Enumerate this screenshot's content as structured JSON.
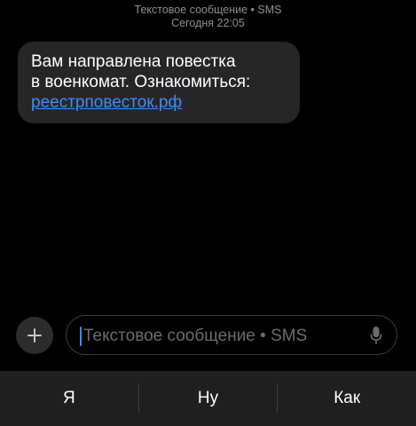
{
  "header": {
    "line1": "Текстовое сообщение • SMS",
    "line2": "Сегодня 22:05"
  },
  "message": {
    "line1": "Вам направлена повестка",
    "line2": "в военкомат. Ознакомиться:",
    "link": "реестрповесток.рф"
  },
  "composer": {
    "plus_icon": "plus-icon",
    "placeholder": "Текстовое сообщение • SMS",
    "mic_icon": "microphone-icon"
  },
  "suggestions": [
    "Я",
    "Ну",
    "Как"
  ],
  "colors": {
    "background": "#000000",
    "bubble": "#262628",
    "link": "#3e8ef7",
    "caret": "#3e8ef7",
    "meta_text": "#8e8e93",
    "suggest_bar": "#1f1f21"
  }
}
